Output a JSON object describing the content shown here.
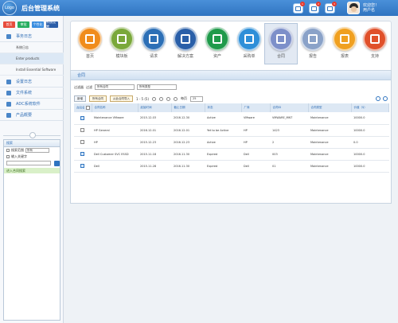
{
  "header": {
    "logo": "Logo",
    "title": "后台管理系统",
    "welcome_line1": "欢迎您！",
    "welcome_line2": "用户名",
    "notif_badges": [
      "1",
      "2",
      "3"
    ]
  },
  "sidebar": {
    "buttons": [
      {
        "label": "首页",
        "color": "#e74c3c"
      },
      {
        "label": "审批",
        "color": "#27ae60"
      },
      {
        "label": "个性化",
        "color": "#3b8ee0"
      },
      {
        "label": "系统设置",
        "color": "#2c5ea8"
      }
    ],
    "nav": [
      {
        "label": "事务日志"
      },
      {
        "label": "设置日志"
      },
      {
        "label": "文件系统"
      },
      {
        "label": "ADC系统软件"
      },
      {
        "label": "产品概要"
      }
    ],
    "sub_items": [
      "系统日志",
      "Enter products",
      "Install Essential Software"
    ],
    "search": {
      "title": "搜索",
      "scope_label": "搜索范围",
      "scope_value": "所有",
      "keyword_label": "输入关键字",
      "result_text": "进入合同搜索"
    }
  },
  "icon_bar": {
    "tiles": [
      {
        "label": "首页",
        "icon": "home-icon",
        "color": "#f08c1c"
      },
      {
        "label": "模块板",
        "icon": "tools-icon",
        "color": "#7aa83a"
      },
      {
        "label": "请求",
        "icon": "chat-icon",
        "color": "#2c6fb6"
      },
      {
        "label": "解决方案",
        "icon": "pen-icon",
        "color": "#2a5fa8"
      },
      {
        "label": "资产",
        "icon": "coins-icon",
        "color": "#1f9a4a"
      },
      {
        "label": "采购单",
        "icon": "document-icon",
        "color": "#2e8fd8"
      },
      {
        "label": "合同",
        "icon": "contract-icon",
        "color": "#7d8fc9"
      },
      {
        "label": "报告",
        "icon": "gear-icon",
        "color": "#8aa2c8"
      },
      {
        "label": "报表",
        "icon": "report-icon",
        "color": "#f0a020"
      },
      {
        "label": "支持",
        "icon": "support-icon",
        "color": "#e0502a"
      }
    ],
    "active_index": 6
  },
  "panel": {
    "title": "合同",
    "filter_label": "过滤器",
    "filter_type": "过滤",
    "filter_value1": "所有合同",
    "filter_value2": "所有类型",
    "toolbar": {
      "btn1": "新增",
      "btn2": "所有合同",
      "btn3": "从此合同导入",
      "page_text": "1 - 5 (5)",
      "per_page_label": "每页",
      "per_page_value": "25"
    },
    "columns": [
      "合同名",
      "合同名称",
      "起始时间",
      "截止日期",
      "状态",
      "厂商",
      "合同ID",
      "合同类型",
      "价值（$）"
    ],
    "rows": [
      {
        "checked": true,
        "name": "Maintenance VMware",
        "start": "2015.12.03",
        "end": "2016.12.30",
        "status": "Active",
        "vendor": "VMware",
        "id": "VMWARE_MNT",
        "type": "Maintenance",
        "value": "10000.0"
      },
      {
        "checked": false,
        "name": "HP General",
        "start": "2016.12.01",
        "end": "2016.12.01",
        "status": "Yet to be Active",
        "vendor": "HP",
        "id": "1423",
        "type": "Maintenance",
        "value": "10000.0"
      },
      {
        "checked": false,
        "name": "HP",
        "start": "2015.12.23",
        "end": "2016.12.23",
        "status": "Active",
        "vendor": "HP",
        "id": "2",
        "type": "Maintenance",
        "value": "0.0"
      },
      {
        "checked": true,
        "name": "Dell Customer SVC ESSD",
        "start": "2015.11.18",
        "end": "2016.11.30",
        "status": "Expired",
        "vendor": "Dell",
        "id": "003",
        "type": "Maintenance",
        "value": "10000.0"
      },
      {
        "checked": true,
        "name": "Dell",
        "start": "2015.11.28",
        "end": "2016.11.30",
        "status": "Expired",
        "vendor": "Dell",
        "id": "01",
        "type": "Maintenance",
        "value": "10000.0"
      }
    ]
  }
}
